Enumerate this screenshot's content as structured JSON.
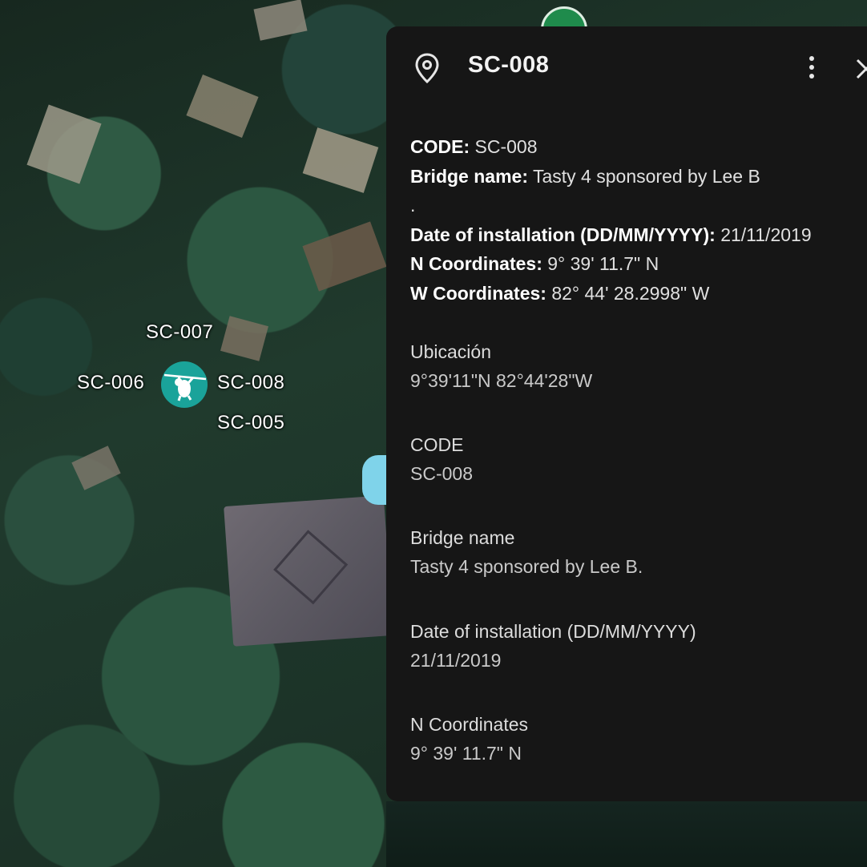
{
  "map": {
    "labels": {
      "sc007": "SC-007",
      "sc006": "SC-006",
      "sc008": "SC-008",
      "sc005": "SC-005"
    },
    "colors": {
      "marker": "#1aa39a",
      "top_marker": "#1f8b4c",
      "panel_bg": "#161616"
    }
  },
  "panel": {
    "title": "SC-008",
    "pin_icon": "location-pin-icon",
    "menu_icon": "more-vert-icon",
    "close_icon": "close-icon",
    "description": {
      "code_label": "CODE",
      "code_value": "SC-008",
      "bridge_label": "Bridge name",
      "bridge_value": "Tasty 4 sponsored by Lee B",
      "dot": ".",
      "date_label": "Date of installation (DD/MM/YYYY)",
      "date_value": "21/11/2019",
      "n_label": "N Coordinates",
      "n_value": "9° 39' 11.7\" N",
      "w_label": "W Coordinates",
      "w_value": "82° 44' 28.2998\" W"
    },
    "fields": [
      {
        "label": "Ubicación",
        "value": "9°39'11\"N 82°44'28\"W"
      },
      {
        "label": "CODE",
        "value": "SC-008"
      },
      {
        "label": "Bridge name",
        "value": "Tasty 4 sponsored by Lee B."
      },
      {
        "label": "Date of installation (DD/MM/YYYY)",
        "value": "21/11/2019"
      },
      {
        "label": "N Coordinates",
        "value": "9° 39' 11.7\" N"
      }
    ]
  }
}
